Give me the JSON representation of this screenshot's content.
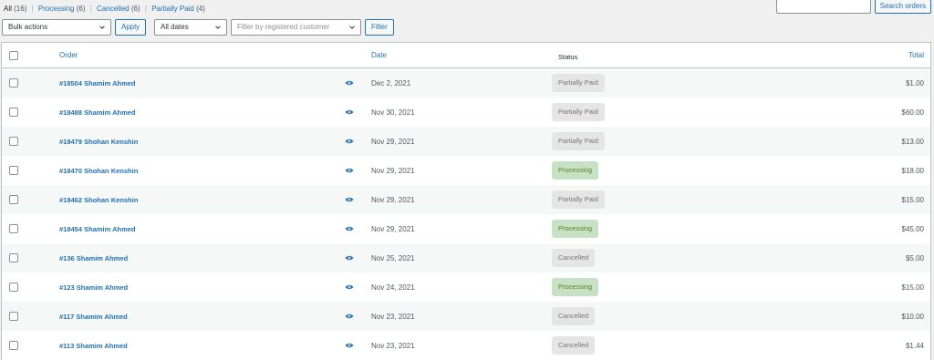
{
  "views": [
    {
      "label": "All",
      "count": "(16)",
      "current": true
    },
    {
      "label": "Processing",
      "count": "(6)"
    },
    {
      "label": "Cancelled",
      "count": "(6)"
    },
    {
      "label": "Partially Paid",
      "count": "(4)"
    }
  ],
  "search": {
    "placeholder": "",
    "button_label": "Search orders"
  },
  "filters": {
    "bulk_actions": "Bulk actions",
    "apply_label": "Apply",
    "dates": "All dates",
    "customer_placeholder": "Filter by registered customer",
    "filter_label": "Filter"
  },
  "table": {
    "headers": {
      "order": "Order",
      "date": "Date",
      "status": "Status",
      "total": "Total"
    },
    "rows": [
      {
        "order": "#18504 Shamim Ahmed",
        "date": "Dec 2, 2021",
        "status": "Partially Paid",
        "status_key": "partial",
        "total": "$1.00"
      },
      {
        "order": "#18488 Shamim Ahmed",
        "date": "Nov 30, 2021",
        "status": "Partially Paid",
        "status_key": "partial",
        "total": "$60.00"
      },
      {
        "order": "#18479 Shohan Kenshin",
        "date": "Nov 29, 2021",
        "status": "Partially Paid",
        "status_key": "partial",
        "total": "$13.00"
      },
      {
        "order": "#18470 Shohan Kenshin",
        "date": "Nov 29, 2021",
        "status": "Processing",
        "status_key": "processing",
        "total": "$18.00"
      },
      {
        "order": "#18462 Shohan Kenshin",
        "date": "Nov 29, 2021",
        "status": "Partially Paid",
        "status_key": "partial",
        "total": "$15.00"
      },
      {
        "order": "#18454 Shamim Ahmed",
        "date": "Nov 29, 2021",
        "status": "Processing",
        "status_key": "processing",
        "total": "$45.00"
      },
      {
        "order": "#136 Shamim Ahmed",
        "date": "Nov 25, 2021",
        "status": "Cancelled",
        "status_key": "cancelled",
        "total": "$5.00"
      },
      {
        "order": "#123 Shamim Ahmed",
        "date": "Nov 24, 2021",
        "status": "Processing",
        "status_key": "processing",
        "total": "$15.00"
      },
      {
        "order": "#117 Shamim Ahmed",
        "date": "Nov 23, 2021",
        "status": "Cancelled",
        "status_key": "cancelled",
        "total": "$10.00"
      },
      {
        "order": "#113 Shamim Ahmed",
        "date": "Nov 23, 2021",
        "status": "Cancelled",
        "status_key": "cancelled",
        "total": "$1.44"
      }
    ]
  },
  "colors": {
    "link": "#2271b1",
    "processing_bg": "#c6e1c6",
    "processing_text": "#5b841b",
    "neutral_bg": "#e5e5e5"
  },
  "icons": {
    "preview": "eye-icon",
    "dropdown": "chevron-down-icon"
  }
}
